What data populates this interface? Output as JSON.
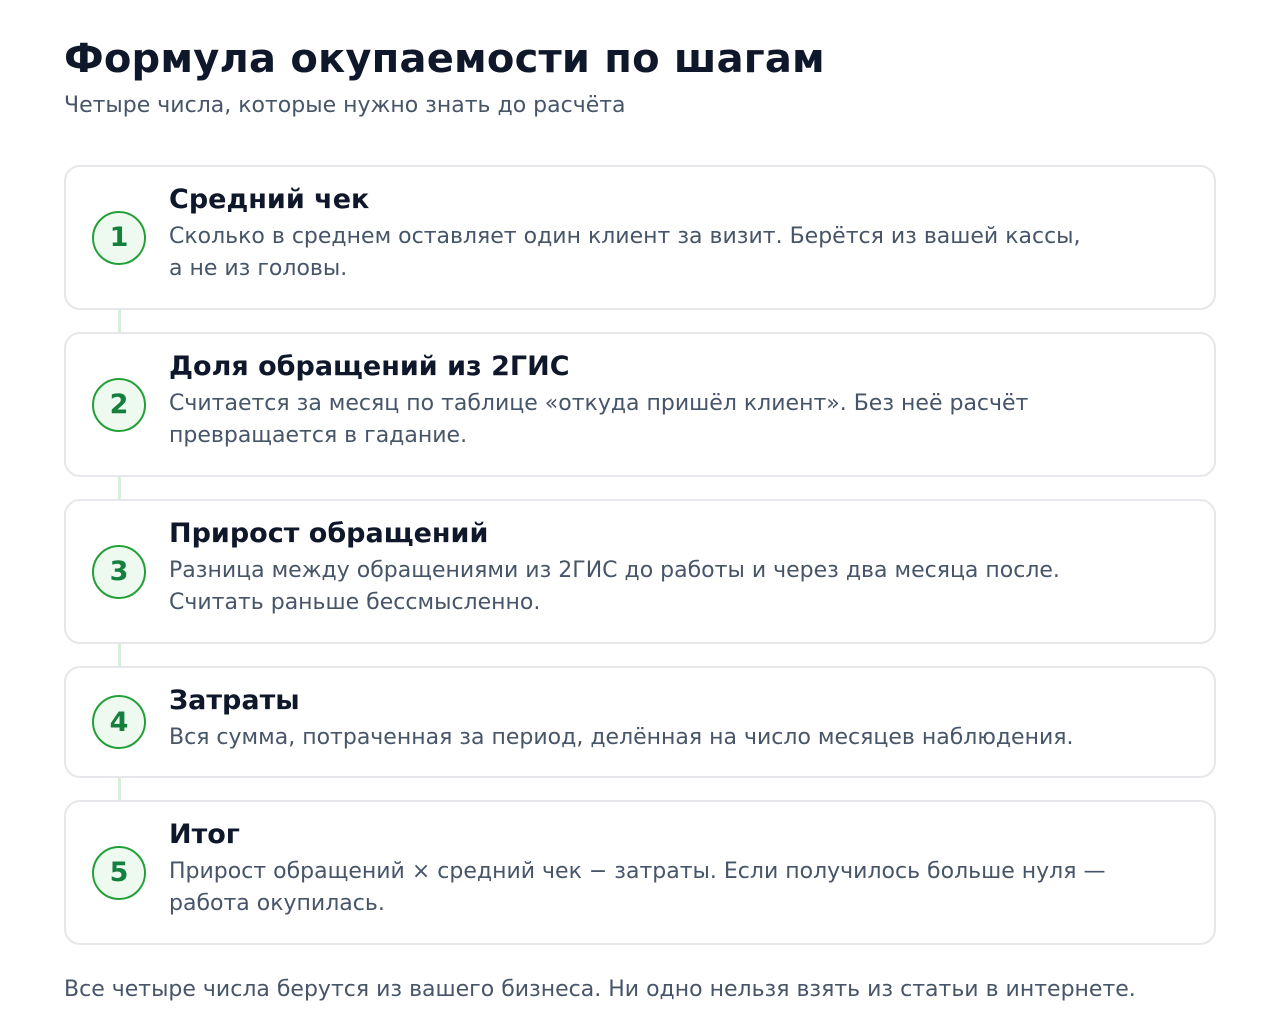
{
  "header": {
    "title": "Формула окупаемости по шагам",
    "subtitle": "Четыре числа, которые нужно знать до расчёта"
  },
  "steps": [
    {
      "number": "1",
      "title": "Средний чек",
      "text_line1": "Сколько в среднем оставляет один клиент за визит. Берётся из вашей кассы,",
      "text_line2": "а не из головы."
    },
    {
      "number": "2",
      "title": "Доля обращений из 2ГИС",
      "text_line1": "Считается за месяц по таблице «откуда пришёл клиент». Без неё расчёт",
      "text_line2": "превращается в гадание."
    },
    {
      "number": "3",
      "title": "Прирост обращений",
      "text_line1": "Разница между обращениями из 2ГИС до работы и через два месяца после.",
      "text_line2": "Считать раньше бессмысленно."
    },
    {
      "number": "4",
      "title": "Затраты",
      "text_line1": "Вся сумма, потраченная за период, делённая на число месяцев наблюдения."
    },
    {
      "number": "5",
      "title": "Итог",
      "text_line1": "Прирост обращений × средний чек − затраты. Если получилось больше нуля —",
      "text_line2": "работа окупилась."
    }
  ],
  "footer": {
    "note": "Все четыре числа берутся из вашего бизнеса. Ни одно нельзя взять из статьи в интернете."
  },
  "colors": {
    "accent": "#22a037",
    "accent_text": "#15803d",
    "badge_bg": "#eefaf0",
    "connector": "#d5efdc",
    "card_border": "#e5e7eb",
    "title": "#0f172a",
    "muted": "#475569"
  }
}
